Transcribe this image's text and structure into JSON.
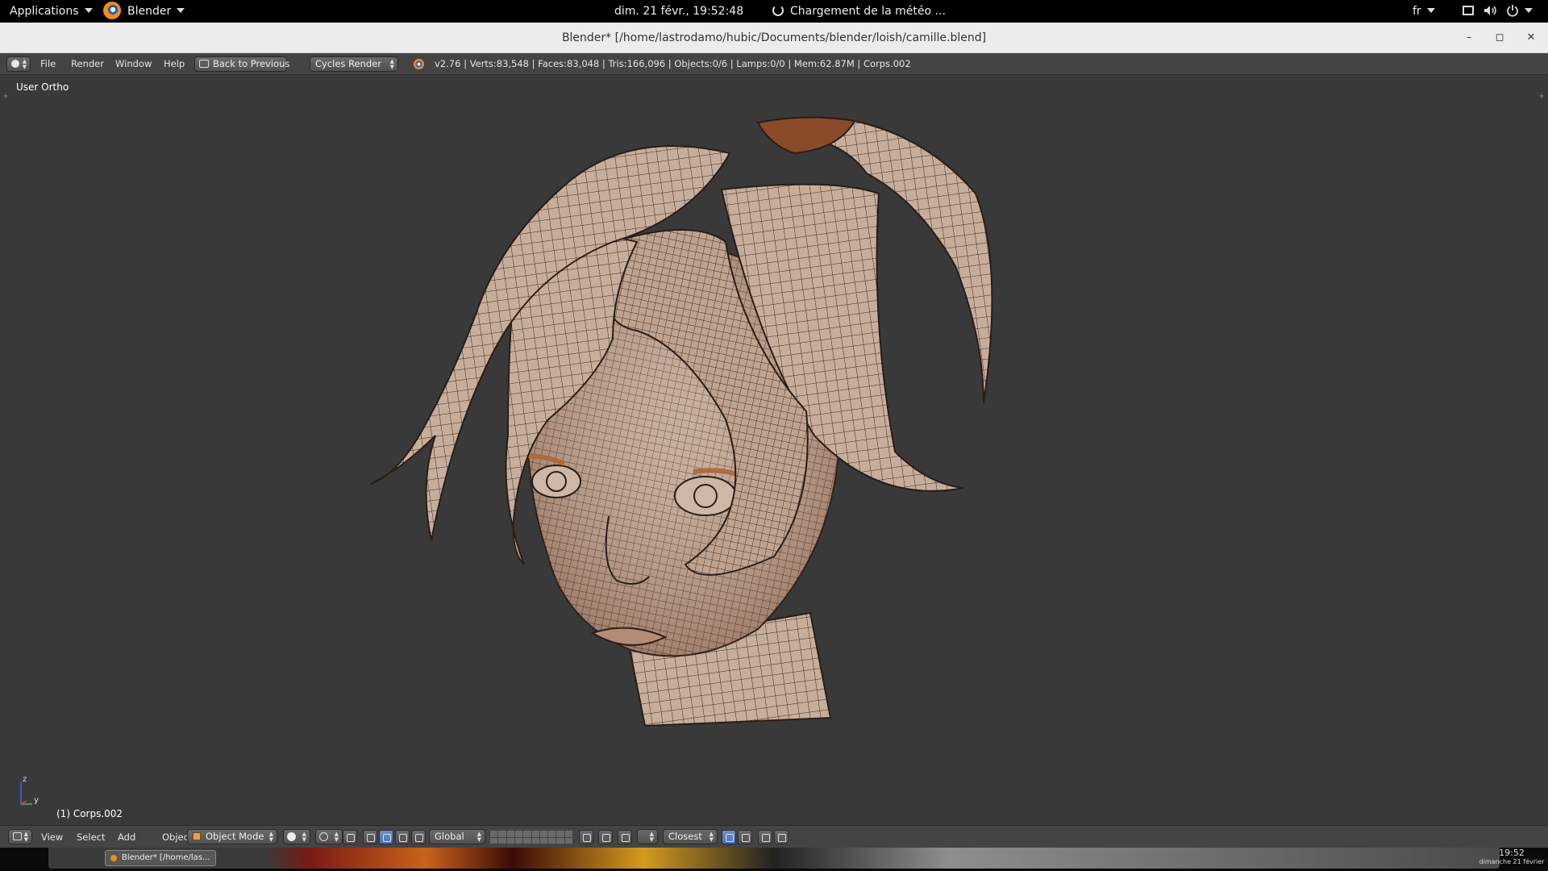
{
  "topbar": {
    "applications_label": "Applications",
    "app_label": "Blender",
    "clock": "dim. 21 févr., 19:52:48",
    "weather": "Chargement de la météo ...",
    "language": "fr"
  },
  "window": {
    "title": "Blender* [/home/lastrodamo/hubic/Documents/blender/loish/camille.blend]",
    "minimize_glyph": "–",
    "maximize_glyph": "◻",
    "close_glyph": "✕"
  },
  "info_header": {
    "menus": [
      "File",
      "Render",
      "Window",
      "Help"
    ],
    "back_button": "Back to Previous",
    "render_engine": "Cycles Render",
    "stats": "v2.76 | Verts:83,548 | Faces:83,048 | Tris:166,096 | Objects:0/6 | Lamps:0/0 | Mem:62.87M | Corps.002"
  },
  "viewport": {
    "view_name": "User Ortho",
    "object_label": "(1) Corps.002",
    "axis_z": "z",
    "axis_y": "y"
  },
  "view3d_header": {
    "menus": [
      "View",
      "Select",
      "Add",
      "Object"
    ],
    "mode": "Object Mode",
    "orientation": "Global",
    "snap_target": "Closest"
  },
  "taskbar": {
    "item": "Blender* [/home/las...",
    "time": "19:52",
    "date": "dimanche 21 février"
  },
  "icons": [
    "blender-logo-icon",
    "refresh-icon",
    "window-icon",
    "volume-icon",
    "power-icon",
    "info-editor-icon",
    "render-icon",
    "mode-cube-icon",
    "shading-sphere-icon",
    "manipulator-icon",
    "layer-grid-icon",
    "snap-magnet-icon",
    "render-preview-icon"
  ],
  "colors": {
    "viewport_bg": "#393939",
    "header_bg": "#444444",
    "accent": "#4772b3",
    "mesh_skin": "#c9b2a0"
  }
}
